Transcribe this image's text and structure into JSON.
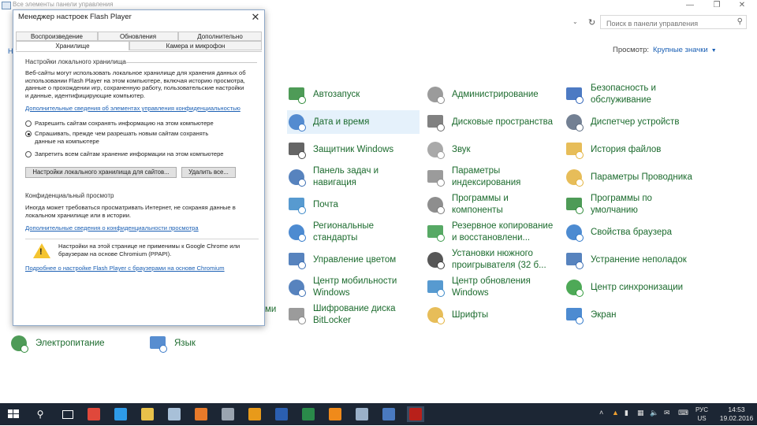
{
  "control_panel": {
    "window_title": "Все элементы панели управления",
    "search_placeholder": "Поиск в панели управления",
    "view_label": "Просмотр:",
    "view_value": "Крупные значки",
    "items": [
      {
        "label": "Автозапуск",
        "icon": "autoplay-icon",
        "color": "#2f8a3a"
      },
      {
        "label": "Администрирование",
        "icon": "admin-tools-icon",
        "color": "#8a8a8a"
      },
      {
        "label": "Безопасность и обслуживание",
        "icon": "security-flag-icon",
        "color": "#2e63b8"
      },
      {
        "label": "Дата и время",
        "icon": "calendar-clock-icon",
        "color": "#3a79c8"
      },
      {
        "label": "Дисковые пространства",
        "icon": "storage-spaces-icon",
        "color": "#6b6b6b"
      },
      {
        "label": "Диспетчер устройств",
        "icon": "device-manager-icon",
        "color": "#5a6a80"
      },
      {
        "label": "Защитник Windows",
        "icon": "defender-icon",
        "color": "#4a4a4a"
      },
      {
        "label": "Звук",
        "icon": "speaker-icon",
        "color": "#9a9a9a"
      },
      {
        "label": "История файлов",
        "icon": "file-history-icon",
        "color": "#e3b23c"
      },
      {
        "label": "Панель задач и навигация",
        "icon": "taskbar-icon",
        "color": "#3a6db3"
      },
      {
        "label": "Параметры индексирования",
        "icon": "indexing-icon",
        "color": "#8a8a8a"
      },
      {
        "label": "Параметры Проводника",
        "icon": "explorer-options-icon",
        "color": "#e3b23c"
      },
      {
        "label": "Почта",
        "icon": "mail-icon",
        "color": "#3a88c8"
      },
      {
        "label": "Программы и компоненты",
        "icon": "programs-icon",
        "color": "#7a7a7a"
      },
      {
        "label": "Программы по умолчанию",
        "icon": "default-programs-icon",
        "color": "#2f8a3a"
      },
      {
        "label": "Региональные стандарты",
        "icon": "region-globe-icon",
        "color": "#2e77c9"
      },
      {
        "label": "Резервное копирование и восстановлени...",
        "icon": "backup-icon",
        "color": "#3a9a4a"
      },
      {
        "label": "Свойства браузера",
        "icon": "internet-options-icon",
        "color": "#2e77c9"
      },
      {
        "label": "Управление цветом",
        "icon": "color-management-icon",
        "color": "#3a6db3"
      },
      {
        "label": "Установки нюжного проигрывателя (32 б...",
        "icon": "player-settings-icon",
        "color": "#3a3a3a"
      },
      {
        "label": "Устранение неполадок",
        "icon": "troubleshoot-icon",
        "color": "#3a6db3"
      },
      {
        "label": "Центр мобильности Windows",
        "icon": "mobility-center-icon",
        "color": "#3a6db3"
      },
      {
        "label": "Центр обновления Windows",
        "icon": "windows-update-icon",
        "color": "#3a88c8"
      },
      {
        "label": "Центр синхронизации",
        "icon": "sync-center-icon",
        "color": "#2f9a3a"
      },
      {
        "label": "Шифрование диска BitLocker",
        "icon": "bitlocker-icon",
        "color": "#8a8a8a"
      },
      {
        "label": "Шрифты",
        "icon": "fonts-icon",
        "color": "#e3b23c"
      },
      {
        "label": "Экран",
        "icon": "display-icon",
        "color": "#2e77c9"
      },
      {
        "label": "Электропитание",
        "icon": "power-options-icon",
        "color": "#2f8a3a"
      },
      {
        "label": "Язык",
        "icon": "language-icon",
        "color": "#3a79c8"
      }
    ],
    "left_fragment": "ми"
  },
  "flash_dialog": {
    "title": "Менеджер настроек Flash Player",
    "tabs": [
      "Воспроизведение",
      "Обновления",
      "Дополнительно",
      "Хранилище",
      "Камера и микрофон"
    ],
    "local_storage_header": "Настройки локального хранилища",
    "local_storage_text": "Веб-сайты могут использовать локальное хранилище для хранения данных об использовании Flash Player на этом компьютере, включая историю просмотра, данные о прохождении игр, сохраненную работу, пользовательские настройки и данные, идентифицирующие компьютер.",
    "local_storage_link": "Дополнительные сведения об элементах управления конфиденциальностью",
    "radios": [
      {
        "label": "Разрешить сайтам сохранять информацию на этом компьютере",
        "checked": false
      },
      {
        "label": "Спрашивать, прежде чем разрешать новым сайтам сохранять данные на компьютере",
        "checked": true
      },
      {
        "label": "Запретить всем сайтам хранение информации на этом компьютере",
        "checked": false
      }
    ],
    "btn_local_settings": "Настройки локального хранилища для сайтов...",
    "btn_delete_all": "Удалить все...",
    "private_header": "Конфиденциальный просмотр",
    "private_text": "Иногда может требоваться просматривать Интернет, не сохраняя данные в локальном хранилище или в истории.",
    "private_link": "Дополнительные сведения о конфиденциальности просмотра",
    "warning_text": "Настройки на этой странице не применимы к Google Chrome или браузерам на основе Chromium (PPAPI).",
    "chromium_link": "Подробнее о настройке Flash Player с браузерами на основе Chromium"
  },
  "taskbar": {
    "apps": [
      {
        "name": "chrome-icon",
        "color": "#e0483b"
      },
      {
        "name": "internet-explorer-icon",
        "color": "#2e9be8"
      },
      {
        "name": "file-explorer-icon",
        "color": "#e8c14a"
      },
      {
        "name": "notepad-icon",
        "color": "#a8c0d8"
      },
      {
        "name": "media-player-icon",
        "color": "#e87a2a"
      },
      {
        "name": "tool-app-icon",
        "color": "#9aa4b0"
      },
      {
        "name": "outlook-icon",
        "color": "#e89a1a"
      },
      {
        "name": "word-icon",
        "color": "#2b5fb0"
      },
      {
        "name": "excel-icon",
        "color": "#2a8a4a"
      },
      {
        "name": "vlc-icon",
        "color": "#f08a1a"
      },
      {
        "name": "paint-icon",
        "color": "#9ab0c8"
      },
      {
        "name": "photos-icon",
        "color": "#4a7ac0"
      },
      {
        "name": "flash-player-icon",
        "color": "#b8201a"
      }
    ],
    "lang": "РУС",
    "lang_sub": "US",
    "time": "14:53",
    "date": "19.02.2016"
  }
}
